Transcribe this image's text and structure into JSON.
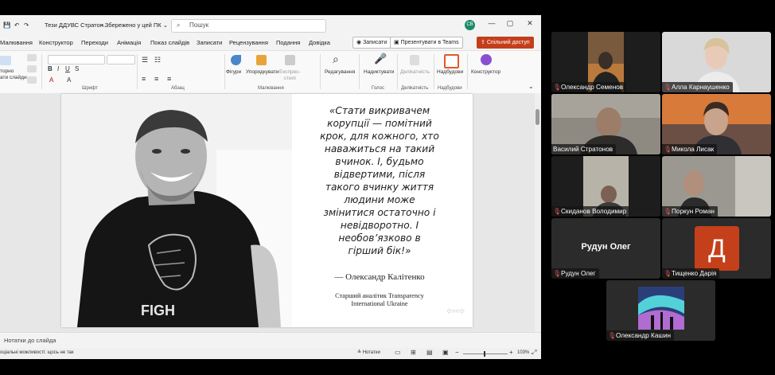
{
  "window": {
    "doc_title": "Тези ДДУВС Стратон...",
    "saved_status": "• Збережено у цей ПК ⌄",
    "search_placeholder": "Пошук",
    "avatar_initials": "СВ",
    "min_btn": "—",
    "max_btn": "▢",
    "close_btn": "✕"
  },
  "menu": {
    "items": [
      "Малювання",
      "Конструктор",
      "Переходи",
      "Анімація",
      "Показ слайдів",
      "Записати",
      "Рецензування",
      "Подання",
      "Довідка"
    ],
    "record_btn": "Записати",
    "present_teams_btn": "Презентувати в Teams",
    "share_btn": "Спільний доступ"
  },
  "ribbon": {
    "groups": [
      "Шрифт",
      "Абзац",
      "Малювання",
      "Голос",
      "Делікатність",
      "Надбудови"
    ],
    "labels": {
      "new_slide": "торно\nати слайди",
      "shapes": "Фігури",
      "arrange": "Упорядкувати",
      "express_styles": "Експрес-\nстилі",
      "editing": "Редагування",
      "dictate": "Надиктувати",
      "sensitivity": "Делікатність",
      "addins": "Надбудови",
      "designer": "Конструктор"
    }
  },
  "slide": {
    "quote": "«Стати викривачем\nкорупції — помітний\nкрок, для кожного, хто\nнаважиться на такий\nвчинок. І, будьмо\nвідвертими, після\nтакого вчинку життя\nлюдини може\nзмінитися остаточно і\nневідворотно. І\nнеобов’язково в\nгірший бік!»",
    "author": "— Олександр Калітенко",
    "role": "Старший аналітик Transparency\nInternational Ukraine",
    "shirt_text": "FIGH"
  },
  "notes_placeholder": "Нотатки до слайда",
  "status": {
    "accessibility": "оціальні можливості: щось не так",
    "notes_btn": "Нотатки",
    "zoom": "103%",
    "zoom_value": 103
  },
  "participants": [
    {
      "name": "Олександр Семенов",
      "muted": true,
      "video": true
    },
    {
      "name": "Алла Карнаушенко",
      "muted": true,
      "video": true
    },
    {
      "name": "Василий Стратонов",
      "muted": false,
      "video": true,
      "active": true
    },
    {
      "name": "Микола Лисак",
      "muted": true,
      "video": true
    },
    {
      "name": "Скиданов Володимир",
      "muted": true,
      "video": true
    },
    {
      "name": "Поркун Роман",
      "muted": true,
      "video": true
    },
    {
      "name": "Рудун Олег",
      "muted": true,
      "video": false,
      "display_name": "Рудун Олег"
    },
    {
      "name": "Тищенко Дарія",
      "muted": true,
      "video": false,
      "initial": "Д"
    },
    {
      "name": "Олександр Кашин",
      "muted": true,
      "video": true
    }
  ],
  "colors": {
    "accent": "#c43e1c",
    "active_speaker": "#6fd39a",
    "avatar_d": "#c4401a"
  }
}
